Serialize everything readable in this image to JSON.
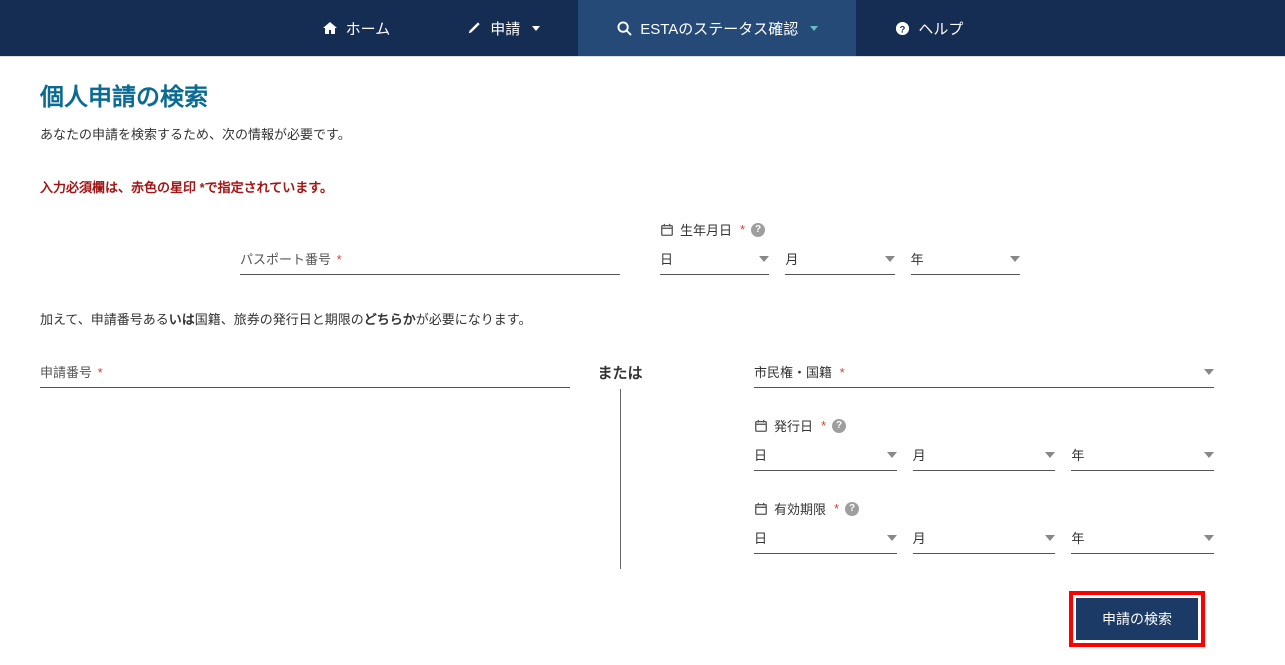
{
  "nav": {
    "home": "ホーム",
    "apply": "申請",
    "check": "ESTAのステータス確認",
    "help": "ヘルプ"
  },
  "page": {
    "title": "個人申請の検索",
    "instruction": "あなたの申請を検索するため、次の情報が必要です。",
    "required_note": "入力必須欄は、赤色の星印 *で指定されています。",
    "additional_pre": "加えて、申請番号ある",
    "additional_bold1": "いは",
    "additional_mid": "国籍、旅券の発行日と期限の",
    "additional_bold2": "どちらか",
    "additional_post": "が必要になります。",
    "or": "または"
  },
  "fields": {
    "passport": "パスポート番号",
    "dob": "生年月日",
    "appnum": "申請番号",
    "citizenship": "市民権・国籍",
    "issue": "発行日",
    "expiry": "有効期限"
  },
  "date": {
    "day": "日",
    "month": "月",
    "year": "年"
  },
  "button": {
    "search": "申請の検索"
  }
}
